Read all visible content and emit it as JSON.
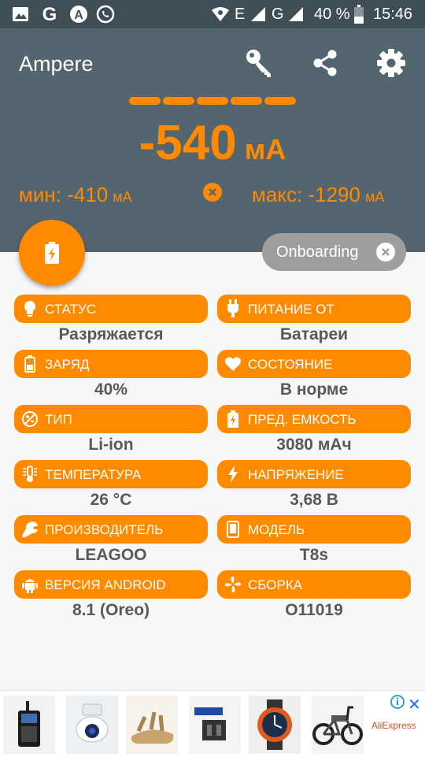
{
  "status_bar": {
    "battery_text": "40 %",
    "time": "15:46",
    "network_e": "E",
    "network_g": "G",
    "icons": [
      "image-icon",
      "google-icon",
      "a-icon",
      "whatsapp-icon",
      "hotspot-icon",
      "signal-icon",
      "signal-icon",
      "battery-icon"
    ]
  },
  "header": {
    "title": "Ampere",
    "current_value": "-540",
    "current_unit": "мА",
    "min_label": "мин: -410",
    "min_unit": "мА",
    "max_label": "макс: -1290",
    "max_unit": "мА",
    "dash_count": 5,
    "actions": [
      "key-icon",
      "share-icon",
      "settings-icon"
    ]
  },
  "onboarding_chip": {
    "label": "Onboarding"
  },
  "cards": [
    {
      "icon": "lightbulb-icon",
      "label": "СТАТУС",
      "value": "Разряжается"
    },
    {
      "icon": "plug-icon",
      "label": "ПИТАНИЕ ОТ",
      "value": "Батареи"
    },
    {
      "icon": "battery-icon",
      "label": "ЗАРЯД",
      "value": "40%"
    },
    {
      "icon": "heart-icon",
      "label": "СОСТОЯНИЕ",
      "value": "В норме"
    },
    {
      "icon": "battery-type-icon",
      "label": "ТИП",
      "value": "Li-ion"
    },
    {
      "icon": "battery-charging-icon",
      "label": "ПРЕД. ЕМКОСТЬ",
      "value": "3080 мАч"
    },
    {
      "icon": "thermometer-icon",
      "label": "ТЕМПЕРАТУРА",
      "value": "26 °C"
    },
    {
      "icon": "flash-icon",
      "label": "НАПРЯЖЕНИЕ",
      "value": "3,68 В"
    },
    {
      "icon": "wrench-icon",
      "label": "ПРОИЗВОДИТЕЛЬ",
      "value": "LEAGOO"
    },
    {
      "icon": "phone-icon",
      "label": "МОДЕЛЬ",
      "value": "T8s"
    },
    {
      "icon": "android-icon",
      "label": "ВЕРСИЯ ANDROID",
      "value": "8.1 (Oreo)"
    },
    {
      "icon": "fan-icon",
      "label": "СБОРКА",
      "value": "O11019"
    }
  ],
  "ad": {
    "brand": "AliExpress",
    "items": [
      "walkie-talkie",
      "security-camera",
      "sandal",
      "toy-parts",
      "smartwatch",
      "e-bike"
    ]
  },
  "colors": {
    "accent": "#ff8a00",
    "header": "#556570",
    "statusbar": "#3f4d55",
    "chip": "#9e9e9e",
    "value_text": "#595959"
  }
}
